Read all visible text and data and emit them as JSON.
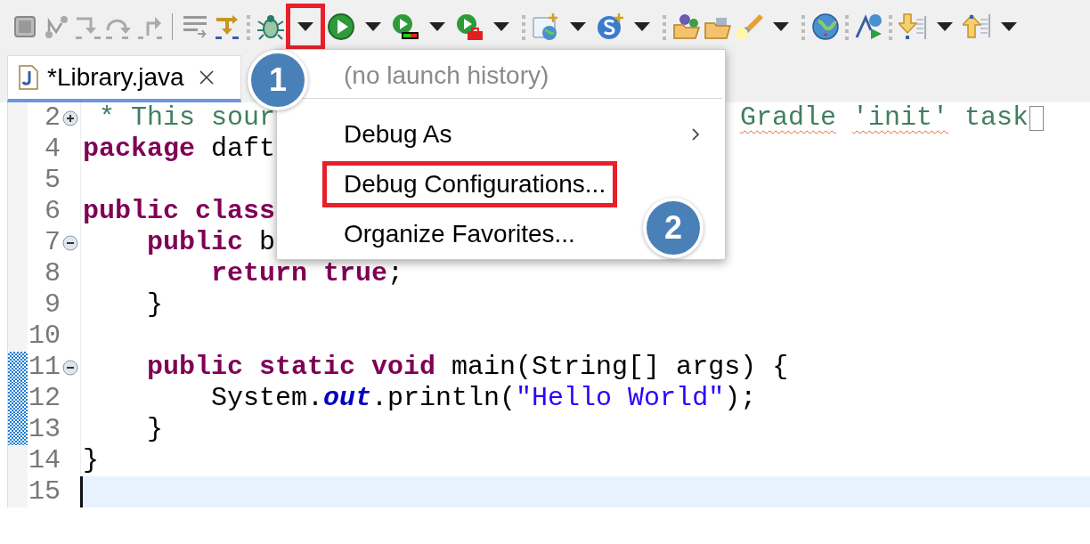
{
  "toolbar": {
    "debug_dropdown_highlighted": true
  },
  "tabs": [
    {
      "label": "*Library.java",
      "selected": true
    }
  ],
  "editor": {
    "lines": [
      {
        "number": "2",
        "collapsed": true,
        "changed": false,
        "current": false,
        "folded_text": true,
        "tokens": [
          {
            "kind": "comment",
            "text": " * This sour"
          }
        ],
        "tokens_right": [
          {
            "kind": "comment",
            "text": "Gradle",
            "misspelled": true
          },
          {
            "kind": "comment",
            "text": " 'init'",
            "misspelled": true
          },
          {
            "kind": "comment",
            "text": " task"
          }
        ]
      },
      {
        "number": "4",
        "changed": false,
        "current": false,
        "folded_text": false,
        "tokens": [
          {
            "kind": "keyword",
            "text": "package"
          },
          {
            "kind": "plain",
            "text": " daft"
          }
        ]
      },
      {
        "number": "5",
        "changed": false,
        "current": false,
        "folded_text": false
      },
      {
        "number": "6",
        "changed": false,
        "current": false,
        "folded_text": false,
        "tokens": [
          {
            "kind": "keyword",
            "text": "public"
          },
          {
            "kind": "keyword",
            "text": " class"
          }
        ]
      },
      {
        "number": "7",
        "collapsed": false,
        "changed": false,
        "current": false,
        "folded_text": false,
        "tokens": [
          {
            "kind": "keyword",
            "text": "    public"
          },
          {
            "kind": "plain",
            "text": " b"
          }
        ]
      },
      {
        "number": "8",
        "changed": false,
        "current": false,
        "folded_text": false,
        "tokens": [
          {
            "kind": "keyword",
            "text": "        return"
          },
          {
            "kind": "keyword",
            "text": " true"
          },
          {
            "kind": "plain",
            "text": ";"
          }
        ]
      },
      {
        "number": "9",
        "changed": false,
        "current": false,
        "folded_text": false,
        "tokens": [
          {
            "kind": "plain",
            "text": "    }"
          }
        ]
      },
      {
        "number": "10",
        "changed": false,
        "current": false,
        "folded_text": false
      },
      {
        "number": "11",
        "collapsed": false,
        "changed": true,
        "current": false,
        "folded_text": false,
        "tokens": [
          {
            "kind": "keyword",
            "text": "    public"
          },
          {
            "kind": "keyword",
            "text": " static"
          },
          {
            "kind": "keyword",
            "text": " void"
          },
          {
            "kind": "plain",
            "text": " main(String[] args) {"
          }
        ]
      },
      {
        "number": "12",
        "changed": true,
        "current": false,
        "folded_text": false,
        "tokens": [
          {
            "kind": "plain",
            "text": "        System."
          },
          {
            "kind": "field",
            "text": "out"
          },
          {
            "kind": "plain",
            "text": ".println("
          },
          {
            "kind": "string",
            "text": "\"Hello World\""
          },
          {
            "kind": "plain",
            "text": ");"
          }
        ]
      },
      {
        "number": "13",
        "changed": true,
        "current": false,
        "folded_text": false,
        "tokens": [
          {
            "kind": "plain",
            "text": "    }"
          }
        ]
      },
      {
        "number": "14",
        "changed": false,
        "current": false,
        "folded_text": false,
        "tokens": [
          {
            "kind": "plain",
            "text": "}"
          }
        ]
      },
      {
        "number": "15",
        "changed": false,
        "current": true,
        "folded_text": false
      }
    ]
  },
  "menu": {
    "items": [
      {
        "kind": "hint",
        "label": "(no launch history)",
        "highlighted": false
      },
      {
        "kind": "separator"
      },
      {
        "kind": "submenu",
        "label": "Debug As",
        "highlighted": false
      },
      {
        "kind": "item",
        "label": "Debug Configurations...",
        "highlighted": true
      },
      {
        "kind": "item",
        "label": "Organize Favorites...",
        "highlighted": false
      }
    ]
  },
  "callouts": [
    {
      "label": "1"
    },
    {
      "label": "2"
    }
  ]
}
